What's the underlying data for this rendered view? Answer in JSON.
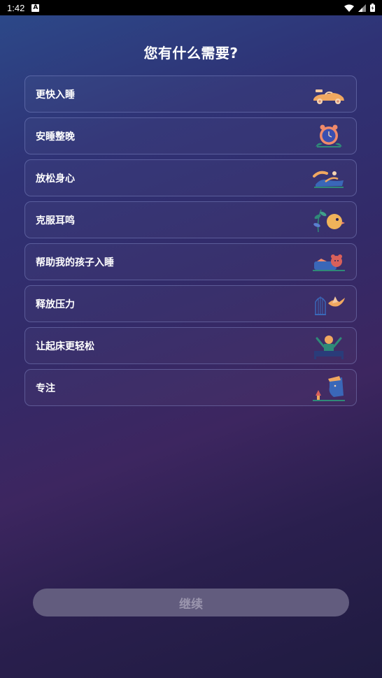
{
  "status_bar": {
    "time": "1:42",
    "notification_icon": "A"
  },
  "title": "您有什么需要?",
  "options": [
    {
      "label": "更快入睡",
      "icon": "race-car-icon"
    },
    {
      "label": "安睡整晚",
      "icon": "alarm-clock-icon"
    },
    {
      "label": "放松身心",
      "icon": "relaxing-person-icon"
    },
    {
      "label": "克服耳鸣",
      "icon": "bird-plant-icon"
    },
    {
      "label": "帮助我的孩子入睡",
      "icon": "child-teddy-icon"
    },
    {
      "label": "释放压力",
      "icon": "birdcage-icon"
    },
    {
      "label": "让起床更轻松",
      "icon": "sunrise-bed-icon"
    },
    {
      "label": "专注",
      "icon": "focus-face-icon"
    }
  ],
  "continue_label": "继续",
  "colors": {
    "accent_orange": "#f0a860",
    "button_disabled": "#625c7e"
  }
}
